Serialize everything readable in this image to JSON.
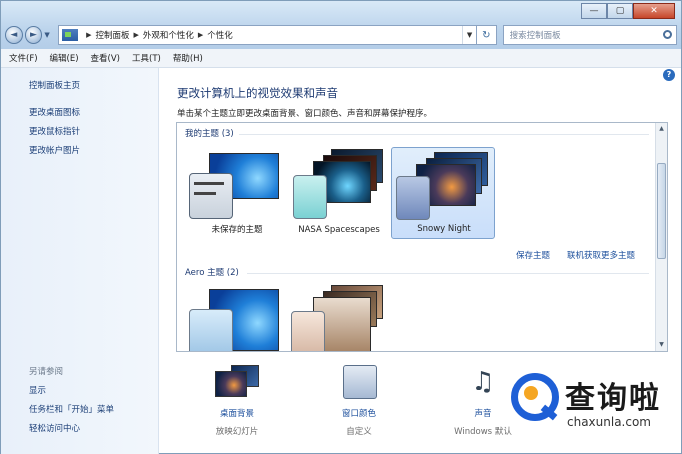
{
  "window": {
    "controls": {
      "minimize": "—",
      "maximize": "▢",
      "close": "✕"
    }
  },
  "nav": {
    "back": "◄",
    "forward": "►",
    "breadcrumb": [
      "控制面板",
      "外观和个性化",
      "个性化"
    ],
    "search_placeholder": "搜索控制面板",
    "refresh": "↻"
  },
  "menu": [
    "文件(F)",
    "编辑(E)",
    "查看(V)",
    "工具(T)",
    "帮助(H)"
  ],
  "sidebar": {
    "items": [
      "控制面板主页",
      "更改桌面图标",
      "更改鼠标指针",
      "更改帐户图片"
    ],
    "see_also_title": "另请参阅",
    "see_also": [
      "显示",
      "任务栏和「开始」菜单",
      "轻松访问中心"
    ]
  },
  "main": {
    "help": "?",
    "title": "更改计算机上的视觉效果和声音",
    "subtitle": "单击某个主题立即更改桌面背景、窗口颜色、声音和屏幕保护程序。",
    "my_themes_label": "我的主题 (3)",
    "themes": [
      {
        "name": "未保存的主题",
        "selected": false
      },
      {
        "name": "NASA Spacescapes",
        "selected": false
      },
      {
        "name": "Snowy Night",
        "selected": true
      }
    ],
    "save_theme": "保存主题",
    "get_more": "联机获取更多主题",
    "aero_label": "Aero 主题 (2)"
  },
  "options": [
    {
      "label": "桌面背景",
      "sub": "放映幻灯片",
      "icon": "desktop-background-icon"
    },
    {
      "label": "窗口颜色",
      "sub": "自定义",
      "icon": "window-color-icon"
    },
    {
      "label": "声音",
      "sub": "Windows 默认",
      "icon": "sound-icon"
    }
  ],
  "watermark": {
    "text": "查询啦",
    "url": "chaxunla.com"
  }
}
